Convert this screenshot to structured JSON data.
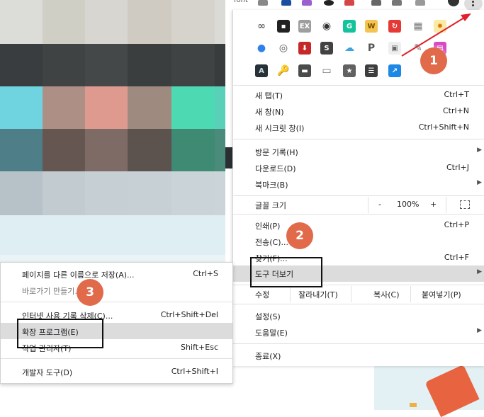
{
  "toolbar": {
    "partial_label": "font"
  },
  "extensions": [
    {
      "icon": "infinity-icon",
      "glyph": "∞",
      "bg": "#ffffff",
      "fg": "#5f6368"
    },
    {
      "icon": "tampermonkey-icon",
      "glyph": "▪",
      "bg": "#222222",
      "fg": "#ffffff"
    },
    {
      "icon": "ex-icon",
      "glyph": "EX",
      "bg": "#9e9e9e",
      "fg": "#ffffff"
    },
    {
      "icon": "speech-icon",
      "glyph": "◉",
      "bg": "#ffffff",
      "fg": "#333333"
    },
    {
      "icon": "grammarly-icon",
      "glyph": "G",
      "bg": "#15c39a",
      "fg": "#ffffff"
    },
    {
      "icon": "w-icon",
      "glyph": "W",
      "bg": "#f3c44f",
      "fg": "#7a4b00"
    },
    {
      "icon": "refresh-red-icon",
      "glyph": "↻",
      "bg": "#e53935",
      "fg": "#ffffff"
    },
    {
      "icon": "grid-icon",
      "glyph": "▦",
      "bg": "#ffffff",
      "fg": "#777777"
    },
    {
      "icon": "sun-icon",
      "glyph": "✹",
      "bg": "#fbe9a6",
      "fg": "#d27b00"
    },
    {
      "icon": "chat-bubble-icon",
      "glyph": "●",
      "bg": "#ffffff",
      "fg": "#2f80ed"
    },
    {
      "icon": "film-reel-icon",
      "glyph": "◎",
      "bg": "#ffffff",
      "fg": "#555555"
    },
    {
      "icon": "download-circle-icon",
      "glyph": "⬇",
      "bg": "#c62828",
      "fg": "#ffffff"
    },
    {
      "icon": "s-icon",
      "glyph": "S",
      "bg": "#424242",
      "fg": "#ffffff"
    },
    {
      "icon": "cloud-icon",
      "glyph": "☁",
      "bg": "#ffffff",
      "fg": "#3ea3e0"
    },
    {
      "icon": "pinterest-icon",
      "glyph": "P",
      "bg": "#ffffff",
      "fg": "#555555"
    },
    {
      "icon": "screen-icon",
      "glyph": "▣",
      "bg": "#eeeeee",
      "fg": "#666666"
    },
    {
      "icon": "key-icon",
      "glyph": "✎",
      "bg": "#ffffff",
      "fg": "#777777"
    },
    {
      "icon": "twitch-icon",
      "glyph": "▤",
      "bg": "#d64cc0",
      "fg": "#ffffff"
    },
    {
      "icon": "a-dark-icon",
      "glyph": "A",
      "bg": "#263238",
      "fg": "#cfd8dc"
    },
    {
      "icon": "search-key-icon",
      "glyph": "🔑",
      "bg": "#ffffff",
      "fg": "#f57c00"
    },
    {
      "icon": "dark-box-icon",
      "glyph": "▬",
      "bg": "#4a4a4a",
      "fg": "#ffffff"
    },
    {
      "icon": "window-icon",
      "glyph": "▭",
      "bg": "#ffffff",
      "fg": "#777777"
    },
    {
      "icon": "star-icon",
      "glyph": "★",
      "bg": "#616161",
      "fg": "#ffffff"
    },
    {
      "icon": "list-icon",
      "glyph": "☰",
      "bg": "#3e3e3e",
      "fg": "#ffffff"
    },
    {
      "icon": "external-link-icon",
      "glyph": "↗",
      "bg": "#1e88e5",
      "fg": "#ffffff"
    }
  ],
  "menu": {
    "new_tab": {
      "label": "새 탭(T)",
      "shortcut": "Ctrl+T"
    },
    "new_window": {
      "label": "새 창(N)",
      "shortcut": "Ctrl+N"
    },
    "new_incognito": {
      "label": "새 시크릿 창(I)",
      "shortcut": "Ctrl+Shift+N"
    },
    "history": {
      "label": "방문 기록(H)"
    },
    "downloads": {
      "label": "다운로드(D)",
      "shortcut": "Ctrl+J"
    },
    "bookmarks": {
      "label": "북마크(B)"
    },
    "zoom": {
      "label": "글꼴 크기",
      "minus": "-",
      "value": "100%",
      "plus": "+"
    },
    "print": {
      "label": "인쇄(P)",
      "shortcut": "Ctrl+P"
    },
    "cast": {
      "label": "전송(C)..."
    },
    "find": {
      "label": "찾기(F)...",
      "shortcut": "Ctrl+F"
    },
    "more_tools": {
      "label": "도구 더보기"
    },
    "edit": {
      "label": "수정",
      "cut": "잘라내기(T)",
      "copy": "복사(C)",
      "paste": "붙여넣기(P)"
    },
    "settings": {
      "label": "설정(S)"
    },
    "help": {
      "label": "도움말(E)"
    },
    "exit": {
      "label": "종료(X)"
    }
  },
  "submenu": {
    "save_as": {
      "label": "페이지를 다른 이름으로 저장(A)...",
      "shortcut": "Ctrl+S"
    },
    "create_shortcut": {
      "label": "바로가기 만들기..."
    },
    "clear_data": {
      "label": "인터넷 사용 기록 삭제(C)...",
      "shortcut": "Ctrl+Shift+Del"
    },
    "extensions": {
      "label": "확장 프로그램(E)"
    },
    "task_manager": {
      "label": "작업 관리자(T)",
      "shortcut": "Shift+Esc"
    },
    "dev_tools": {
      "label": "개발자 도구(D)",
      "shortcut": "Ctrl+Shift+I"
    }
  },
  "annotations": {
    "step1": "1",
    "step2": "2",
    "step3": "3"
  },
  "colors": {
    "badge": "#e06a4a",
    "arrow": "#e0202a",
    "highlight": "#dcdcdc"
  }
}
